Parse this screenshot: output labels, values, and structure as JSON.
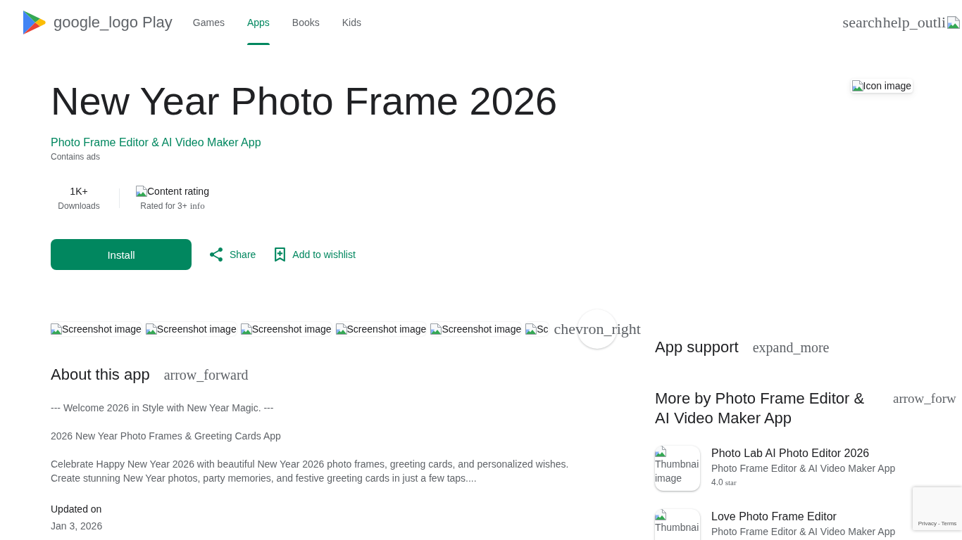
{
  "header": {
    "logo": "google_logo Play",
    "tabs": [
      {
        "label": "Games",
        "selected": false
      },
      {
        "label": "Apps",
        "selected": true
      },
      {
        "label": "Books",
        "selected": false
      },
      {
        "label": "Kids",
        "selected": false
      }
    ],
    "actions": [
      {
        "kind": "search",
        "label": "search"
      },
      {
        "kind": "help",
        "label": "help_outli"
      }
    ]
  },
  "app": {
    "title": "New Year Photo Frame 2026",
    "developer": "Photo Frame Editor & AI Video Maker App",
    "ads_note": "Contains ads",
    "icon_alt": "Icon image",
    "stats": [
      {
        "kind": "count",
        "value": "1K+",
        "label": "Downloads"
      },
      {
        "kind": "rating",
        "image_alt": "Content rating",
        "label": "Rated for 3+",
        "info": "info"
      }
    ],
    "install": "Install",
    "share": "Share",
    "wishlist": "Add to wishlist"
  },
  "screenshots": {
    "items": [
      "Screenshot image",
      "Screenshot image",
      "Screenshot image",
      "Screenshot image",
      "Screenshot image",
      "Sc"
    ],
    "next": "chevron_right"
  },
  "about": {
    "title": "About this app",
    "arrow": "arrow_forward",
    "paragraphs": [
      "--- Welcome 2026 in Style with New Year Magic. ---",
      "2026 New Year Photo Frames & Greeting Cards App",
      "Celebrate Happy New Year 2026 with beautiful New Year 2026 photo frames, greeting cards, and personalized wishes.\nCreate stunning New Year photos, party memories, and festive greeting cards in just a few taps...."
    ],
    "updated_label": "Updated on",
    "updated_value": "Jan 3, 2026"
  },
  "sidebar": {
    "support": {
      "title": "App support",
      "toggle": "expand_more"
    },
    "more_by": {
      "title": "More by Photo Frame Editor & AI Video Maker App",
      "arrow": "arrow_forw",
      "apps": [
        {
          "thumbnail_alt": "Thumbnai image",
          "title": "Photo Lab AI Photo Editor 2026",
          "developer": "Photo Frame Editor & AI Video Maker App",
          "rating": "4.0",
          "rating_icon_text": "star"
        },
        {
          "thumbnail_alt": "Thumbnai",
          "title": "Love Photo Frame Editor",
          "developer": "Photo Frame Editor & AI Video Maker App"
        }
      ]
    }
  },
  "recaptcha": {
    "links": [
      "Privacy",
      "Terms"
    ],
    "separator": "-"
  }
}
